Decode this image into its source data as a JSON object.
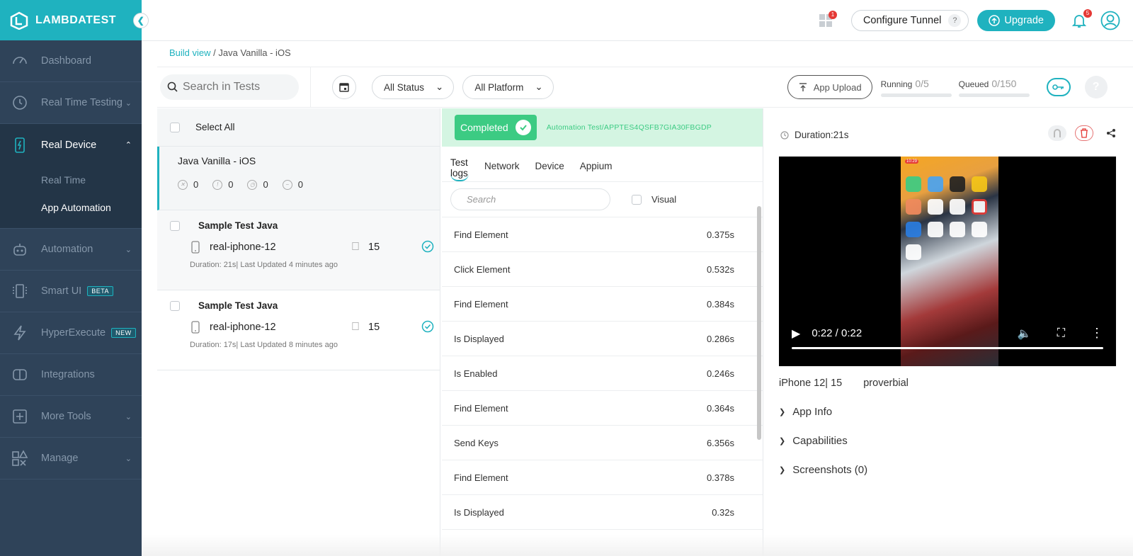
{
  "brand": {
    "name": "LAMBDATEST"
  },
  "sidebar": {
    "items": [
      {
        "label": "Dashboard",
        "icon": "gauge-icon"
      },
      {
        "label": "Real Time Testing",
        "icon": "clock-icon",
        "expandable": true
      },
      {
        "label": "Real Device",
        "icon": "mobile-bolt-icon",
        "expandable": true,
        "active": true,
        "children": [
          {
            "label": "Real Time"
          },
          {
            "label": "App Automation",
            "selected": true
          }
        ]
      },
      {
        "label": "Automation",
        "icon": "robot-icon",
        "expandable": true
      },
      {
        "label": "Smart UI",
        "icon": "smart-ui-icon",
        "badge": "BETA"
      },
      {
        "label": "HyperExecute",
        "icon": "lightning-icon",
        "badge": "NEW"
      },
      {
        "label": "Integrations",
        "icon": "integrations-icon"
      },
      {
        "label": "More Tools",
        "icon": "plus-square-icon",
        "expandable": true
      },
      {
        "label": "Manage",
        "icon": "shapes-icon",
        "expandable": true
      }
    ]
  },
  "topbar": {
    "apps_badge": "1",
    "configure_tunnel": "Configure Tunnel",
    "help_mark": "?",
    "upgrade": "Upgrade",
    "notif_badge": "5"
  },
  "breadcrumb": {
    "link": "Build view",
    "separator": " / ",
    "current": "Java Vanilla - iOS"
  },
  "filters": {
    "search_placeholder": "Search in Tests",
    "status": "All Status",
    "platform": "All Platform",
    "app_upload": "App Upload",
    "running_label": "Running",
    "running_value": "0/5",
    "queued_label": "Queued",
    "queued_value": "0/150"
  },
  "build": {
    "select_all": "Select All",
    "name": "Java Vanilla - iOS",
    "counts": [
      {
        "icon": "failed-icon",
        "value": "0"
      },
      {
        "icon": "error-icon",
        "value": "0"
      },
      {
        "icon": "timeout-icon",
        "value": "0"
      },
      {
        "icon": "skipped-icon",
        "value": "0"
      }
    ]
  },
  "tests": [
    {
      "name": "Sample Test Java",
      "device": "real-iphone-12",
      "os_version": "15",
      "meta": "Duration: 21s| Last Updated 4 minutes ago",
      "status": "passed"
    },
    {
      "name": "Sample Test Java",
      "device": "real-iphone-12",
      "os_version": "15",
      "meta": "Duration: 17s| Last Updated 8 minutes ago",
      "status": "passed"
    }
  ],
  "detail": {
    "status": "Completed",
    "test_id": "Automation Test/APPTES4QSFB7GIA30FBGDP",
    "tabs": [
      "Test logs",
      "Network",
      "Device",
      "Appium"
    ],
    "active_tab": "Test logs",
    "log_search_placeholder": "Search",
    "visual_label": "Visual",
    "logs": [
      {
        "command": "Find Element",
        "time": "0.375s"
      },
      {
        "command": "Click Element",
        "time": "0.532s"
      },
      {
        "command": "Find Element",
        "time": "0.384s"
      },
      {
        "command": "Is Displayed",
        "time": "0.286s"
      },
      {
        "command": "Is Enabled",
        "time": "0.246s"
      },
      {
        "command": "Find Element",
        "time": "0.364s"
      },
      {
        "command": "Send Keys",
        "time": "6.356s"
      },
      {
        "command": "Find Element",
        "time": "0.378s"
      },
      {
        "command": "Is Displayed",
        "time": "0.32s"
      }
    ]
  },
  "video": {
    "duration_label": "Duration:21s",
    "time": "0:22 / 0:22",
    "progress_percent": 100,
    "device": "iPhone 12| 15",
    "app": "proverbial",
    "phone_clock": "10:29"
  },
  "accordion": [
    "App Info",
    "Capabilities",
    "Screenshots (0)"
  ]
}
